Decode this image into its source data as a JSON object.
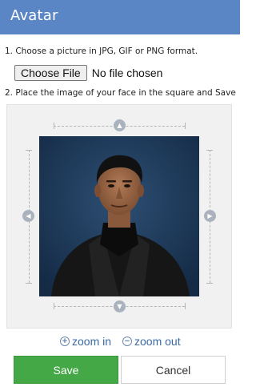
{
  "dialog": {
    "title": "Avatar"
  },
  "instructions": {
    "step1": "1. Choose a picture in JPG, GIF or PNG format.",
    "step2": "2. Place the image of your face in the square and Save"
  },
  "file_input": {
    "button_label": "Choose File",
    "status": "No file chosen"
  },
  "zoom": {
    "zoom_in_label": "zoom in",
    "zoom_out_label": "zoom out"
  },
  "actions": {
    "save_label": "Save",
    "cancel_label": "Cancel"
  },
  "colors": {
    "header": "#5b86c5",
    "save_button": "#43a845",
    "link": "#3a6aa6",
    "handle": "#aab3bd"
  },
  "icons": {
    "handles": [
      "arrow-up-icon",
      "arrow-down-icon",
      "arrow-left-icon",
      "arrow-right-icon"
    ],
    "zoom_in": "zoom-in-icon",
    "zoom_out": "zoom-out-icon"
  }
}
